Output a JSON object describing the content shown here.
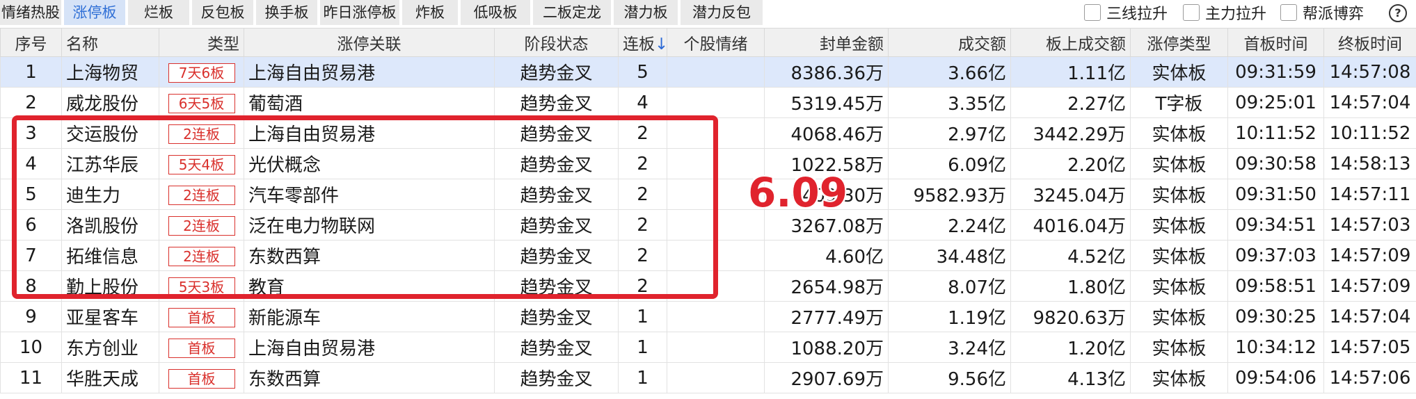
{
  "tabs": [
    {
      "label": "情绪热股",
      "active": false
    },
    {
      "label": "涨停板",
      "active": true
    },
    {
      "label": "烂板",
      "active": false
    },
    {
      "label": "反包板",
      "active": false
    },
    {
      "label": "换手板",
      "active": false
    },
    {
      "label": "昨日涨停板",
      "active": false
    },
    {
      "label": "炸板",
      "active": false
    },
    {
      "label": "低吸板",
      "active": false
    },
    {
      "label": "二板定龙",
      "active": false
    },
    {
      "label": "潜力板",
      "active": false
    },
    {
      "label": "潜力反包",
      "active": false
    }
  ],
  "filters": [
    {
      "label": "三线拉升",
      "checked": false
    },
    {
      "label": "主力拉升",
      "checked": false
    },
    {
      "label": "帮派博弈",
      "checked": false
    }
  ],
  "help_label": "?",
  "columns": [
    "序号",
    "名称",
    "类型",
    "涨停关联",
    "阶段状态",
    "连板↓",
    "个股情绪",
    "封单金额",
    "成交额",
    "板上成交额",
    "涨停类型",
    "首板时间",
    "终板时间"
  ],
  "rows": [
    {
      "idx": "1",
      "name": "上海物贸",
      "link": true,
      "type": "7天6板",
      "assoc": "上海自由贸易港",
      "stage": "趋势金叉",
      "boards": "5",
      "mood": "",
      "seal": "8386.36万",
      "amount": "3.66亿",
      "on_board": "1.11亿",
      "lu_type": "实体板",
      "first": "09:31:59",
      "last": "14:57:08",
      "selected": true
    },
    {
      "idx": "2",
      "name": "威龙股份",
      "link": true,
      "type": "6天5板",
      "assoc": "葡萄酒",
      "stage": "趋势金叉",
      "boards": "4",
      "mood": "",
      "seal": "5319.45万",
      "amount": "3.35亿",
      "on_board": "2.27亿",
      "lu_type": "T字板",
      "first": "09:25:01",
      "last": "14:57:04",
      "selected": false
    },
    {
      "idx": "3",
      "name": "交运股份",
      "link": true,
      "type": "2连板",
      "assoc": "上海自由贸易港",
      "stage": "趋势金叉",
      "boards": "2",
      "mood": "",
      "seal": "4068.46万",
      "amount": "2.97亿",
      "on_board": "3442.29万",
      "lu_type": "实体板",
      "first": "10:11:52",
      "last": "10:11:52",
      "selected": false
    },
    {
      "idx": "4",
      "name": "江苏华辰",
      "link": false,
      "type": "5天4板",
      "assoc": "光伏概念",
      "stage": "趋势金叉",
      "boards": "2",
      "mood": "",
      "seal": "1022.58万",
      "amount": "6.09亿",
      "on_board": "2.20亿",
      "lu_type": "实体板",
      "first": "09:30:58",
      "last": "14:58:13",
      "selected": false
    },
    {
      "idx": "5",
      "name": "迪生力",
      "link": false,
      "type": "2连板",
      "assoc": "汽车零部件",
      "stage": "趋势金叉",
      "boards": "2",
      "mood": "",
      "seal": "6409.30万",
      "amount": "9582.93万",
      "on_board": "3245.04万",
      "lu_type": "实体板",
      "first": "09:31:50",
      "last": "14:57:11",
      "selected": false
    },
    {
      "idx": "6",
      "name": "洛凯股份",
      "link": true,
      "type": "2连板",
      "assoc": "泛在电力物联网",
      "stage": "趋势金叉",
      "boards": "2",
      "mood": "",
      "seal": "3267.08万",
      "amount": "2.24亿",
      "on_board": "4016.04万",
      "lu_type": "实体板",
      "first": "09:34:51",
      "last": "14:57:03",
      "selected": false
    },
    {
      "idx": "7",
      "name": "拓维信息",
      "link": true,
      "type": "2连板",
      "assoc": "东数西算",
      "stage": "趋势金叉",
      "boards": "2",
      "mood": "",
      "seal": "4.60亿",
      "amount": "34.48亿",
      "on_board": "4.52亿",
      "lu_type": "实体板",
      "first": "09:37:03",
      "last": "14:57:09",
      "selected": false
    },
    {
      "idx": "8",
      "name": "勤上股份",
      "link": true,
      "type": "5天3板",
      "assoc": "教育",
      "stage": "趋势金叉",
      "boards": "2",
      "mood": "",
      "seal": "2654.98万",
      "amount": "8.07亿",
      "on_board": "1.80亿",
      "lu_type": "实体板",
      "first": "09:58:51",
      "last": "14:57:09",
      "selected": false
    },
    {
      "idx": "9",
      "name": "亚星客车",
      "link": true,
      "type": "首板",
      "assoc": "新能源车",
      "stage": "趋势金叉",
      "boards": "1",
      "mood": "",
      "seal": "2777.49万",
      "amount": "1.19亿",
      "on_board": "9820.63万",
      "lu_type": "实体板",
      "first": "09:30:25",
      "last": "14:57:04",
      "selected": false
    },
    {
      "idx": "10",
      "name": "东方创业",
      "link": true,
      "type": "首板",
      "assoc": "上海自由贸易港",
      "stage": "趋势金叉",
      "boards": "1",
      "mood": "",
      "seal": "1088.20万",
      "amount": "3.24亿",
      "on_board": "1.20亿",
      "lu_type": "实体板",
      "first": "10:34:12",
      "last": "14:57:05",
      "selected": false
    },
    {
      "idx": "11",
      "name": "华胜天成",
      "link": true,
      "type": "首板",
      "assoc": "东数西算",
      "stage": "趋势金叉",
      "boards": "1",
      "mood": "",
      "seal": "2907.69万",
      "amount": "9.56亿",
      "on_board": "4.13亿",
      "lu_type": "实体板",
      "first": "09:54:06",
      "last": "14:57:06",
      "selected": false
    }
  ],
  "annotation": {
    "text": "6.09",
    "color": "#e0232d"
  },
  "colors": {
    "link": "#2d6ad6",
    "badge": "#d9302c",
    "active_tab_bg": "#d6e3f7",
    "selected_row": "#dde8fb"
  }
}
